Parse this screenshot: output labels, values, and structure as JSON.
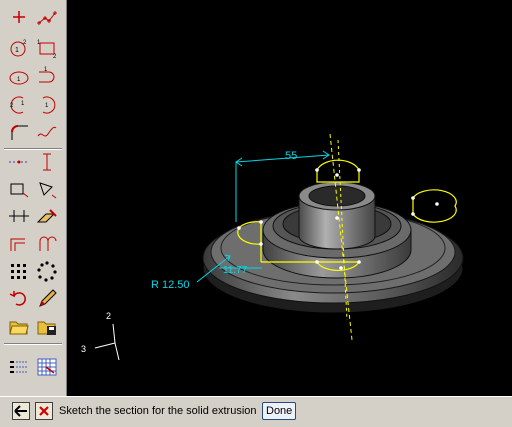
{
  "toolbar": {
    "tools": [
      {
        "icon": "point-icon"
      },
      {
        "icon": "connected-points-icon"
      },
      {
        "icon": "circle-center-perimeter-icon"
      },
      {
        "icon": "rectangle-icon"
      },
      {
        "icon": "ellipse-icon"
      },
      {
        "icon": "arc-tangent-icon"
      },
      {
        "icon": "arc-three-points-icon"
      },
      {
        "icon": "arc-center-ends-icon"
      },
      {
        "icon": "fillet-icon"
      },
      {
        "icon": "spline-icon"
      },
      {
        "icon": "construction-line-icon"
      },
      {
        "icon": "dimension-icon"
      },
      {
        "icon": "constraint-icon"
      },
      {
        "icon": "edit-dimension-icon"
      },
      {
        "icon": "parallel-lines-icon"
      },
      {
        "icon": "edit-tool-icon"
      },
      {
        "icon": "offset-icon"
      },
      {
        "icon": "mirror-icon"
      },
      {
        "icon": "linear-pattern-icon"
      },
      {
        "icon": "radial-pattern-icon"
      },
      {
        "icon": "undo-icon"
      },
      {
        "icon": "pencil-icon"
      },
      {
        "icon": "open-sketch-icon"
      },
      {
        "icon": "save-sketch-icon"
      },
      {
        "icon": "sketch-options-icon"
      },
      {
        "icon": "grid-icon"
      }
    ]
  },
  "viewport": {
    "dim_width": "55",
    "dim_radius": "R 12.50",
    "dim_height": "11.77",
    "triad_y": "2",
    "triad_x": "3",
    "colors": {
      "background": "#000000",
      "dimension": "#00d8e8",
      "sketch": "#ffff00",
      "part": "#5a5a5a"
    }
  },
  "prompt": {
    "back_icon": "back-arrow-icon",
    "cancel_icon": "cancel-x-icon",
    "text": "Sketch the section for the solid extrusion",
    "done_label": "Done"
  }
}
